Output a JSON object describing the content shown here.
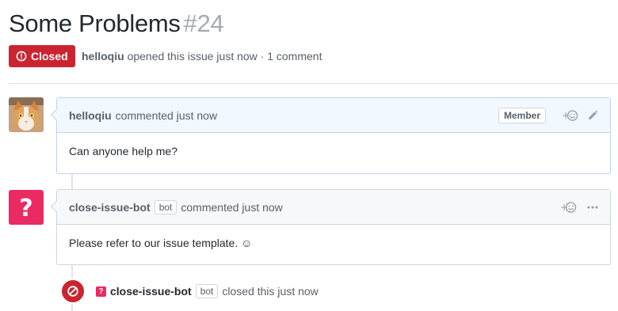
{
  "issue": {
    "title": "Some Problems",
    "number": "#24",
    "state_label": "Closed",
    "state_color": "#cb2431",
    "author": "helloqiu",
    "meta_text": "opened this issue just now · 1 comment"
  },
  "comments": [
    {
      "author": "helloqiu",
      "time_text": "commented just now",
      "role_label": "Member",
      "body": "Can anyone help me?",
      "actions": [
        "add-reaction-icon",
        "pencil-icon"
      ]
    },
    {
      "author": "close-issue-bot",
      "bot_label": "bot",
      "time_text": "commented just now",
      "body": "Please refer to our issue template. ☺",
      "actions": [
        "add-reaction-icon",
        "kebab-icon"
      ]
    }
  ],
  "event": {
    "actor": "close-issue-bot",
    "bot_label": "bot",
    "text": "closed this just now",
    "icon": "circle-slash-icon",
    "color": "#cb2431"
  },
  "colors": {
    "bot_avatar": "#ea2a62",
    "link_gray": "#586069",
    "comment_header_blue": "#f1f8ff"
  }
}
